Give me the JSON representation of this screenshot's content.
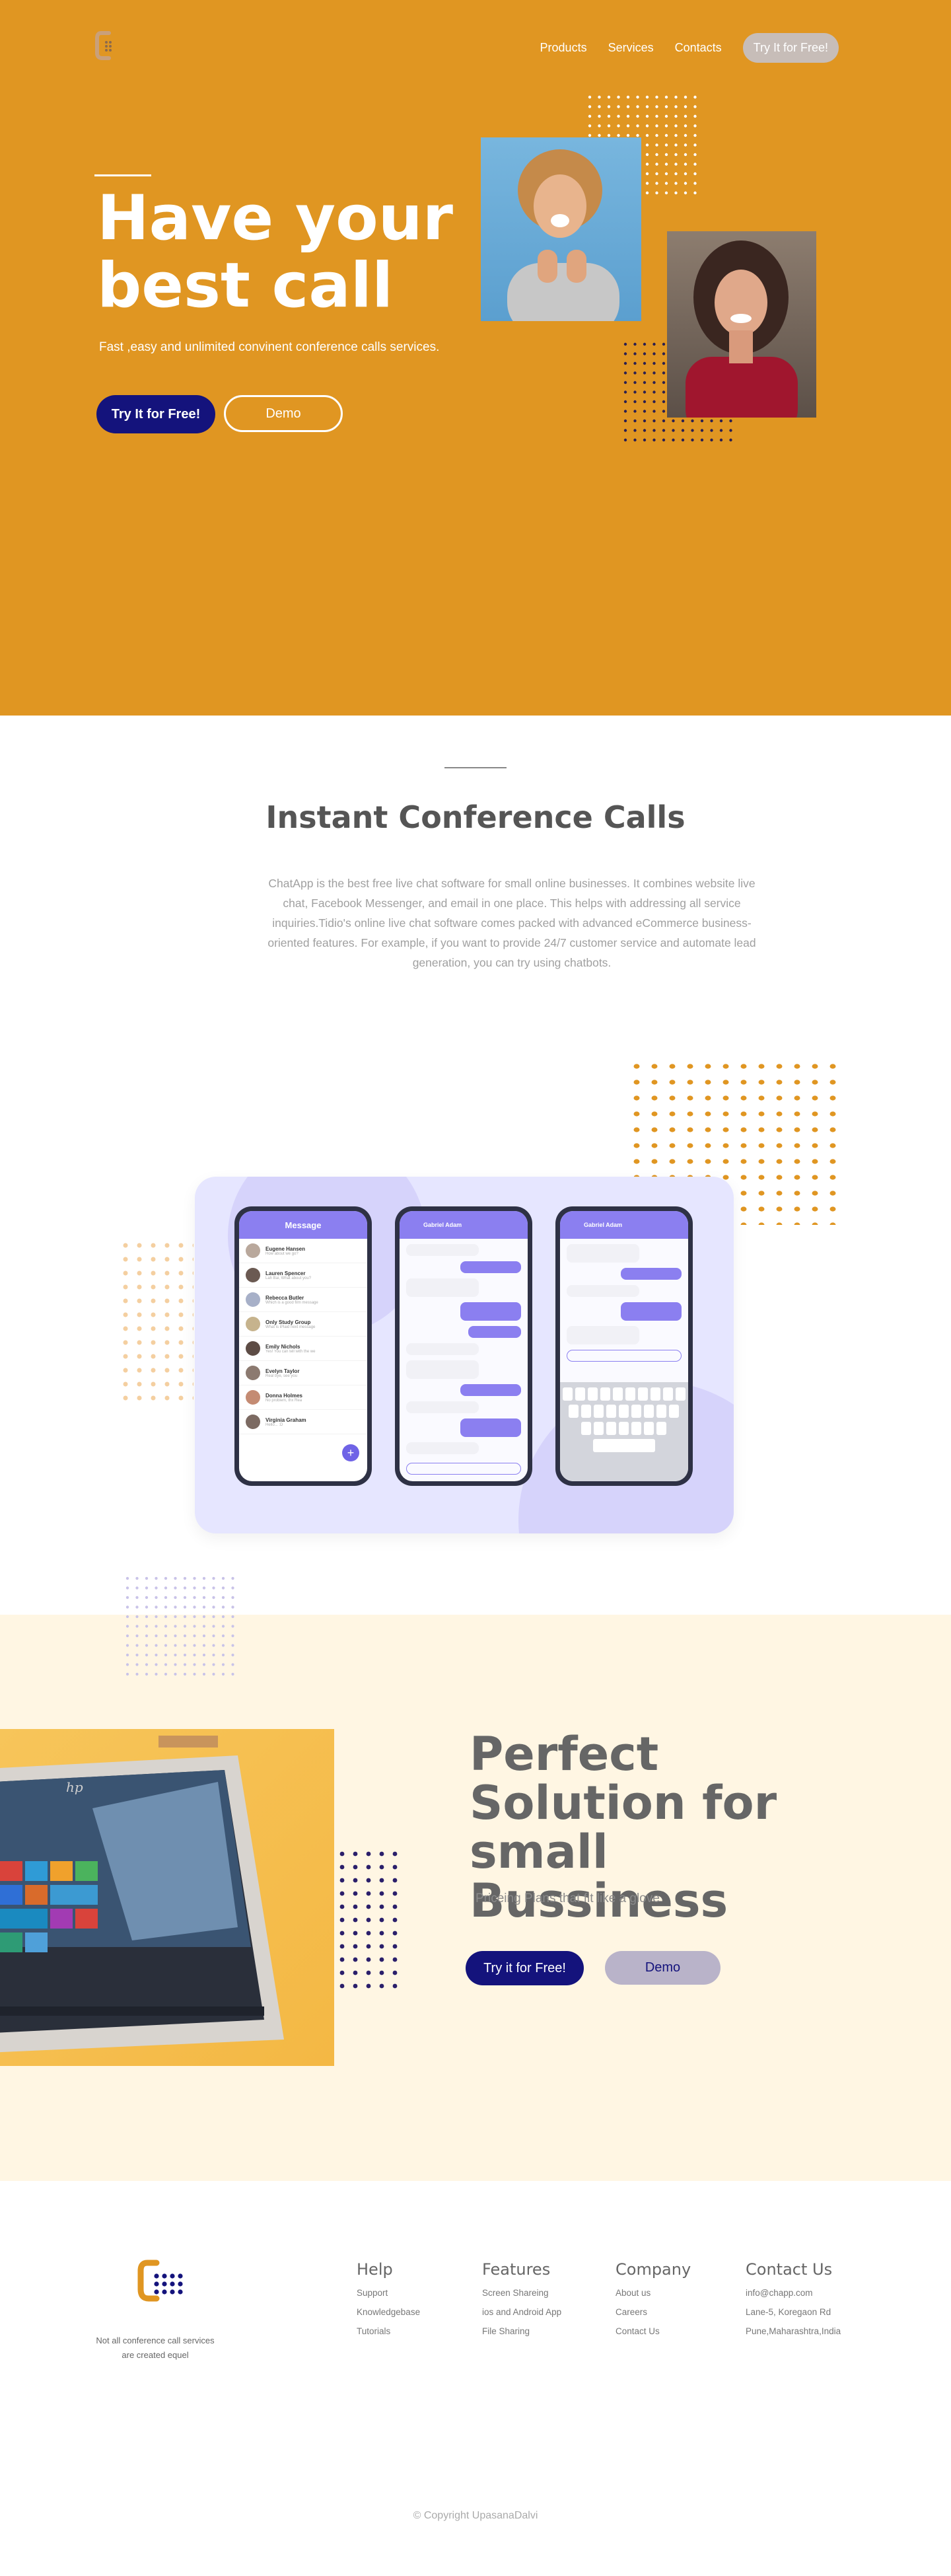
{
  "nav": {
    "items": [
      "Products",
      "Services",
      "Contacts"
    ],
    "cta": "Try It for Free!"
  },
  "hero": {
    "title": "Have your best call",
    "subtitle": "Fast ,easy  and unlimited convinent conference calls services.",
    "try_label": "Try It for Free!",
    "demo_label": "Demo"
  },
  "instant": {
    "title": "Instant  Conference Calls",
    "text": "ChatApp is the best free live chat software for small online businesses. It combines website live chat, Facebook Messenger, and email in one place. This helps with addressing all service inquiries.Tidio's online live chat software comes packed with advanced eCommerce business-oriented features. For example, if you want to provide 24/7 customer service and automate lead generation, you can try using chatbots."
  },
  "app_mock": {
    "header": "Message",
    "contacts": [
      {
        "name": "Eugene Hansen",
        "preview": "How about we go?"
      },
      {
        "name": "Lauren Spencer",
        "preview": "Lah Bai, What about you?"
      },
      {
        "name": "Rebecca Butler",
        "preview": "Which is a good film message"
      },
      {
        "name": "Only Study Group",
        "preview": "What is iPlaid next message"
      },
      {
        "name": "Emily Nichols",
        "preview": "Yes! You can tell with the we"
      },
      {
        "name": "Evelyn Taylor",
        "preview": "Real bye, see you"
      },
      {
        "name": "Donna Holmes",
        "preview": "No problem, thx Rea"
      },
      {
        "name": "Virginia Graham",
        "preview": "Hello... :D"
      }
    ],
    "chat_contact": "Gabriel Adam"
  },
  "solution": {
    "title": "Perfect Solution for small Bussiness",
    "subtitle": "Priceing Plans that fit like a glove",
    "try_label": "Try it for Free!",
    "demo_label": "Demo"
  },
  "footer": {
    "tagline": "Not all conference call services are created equel",
    "columns": [
      {
        "title": "Help",
        "links": [
          "Support",
          "Knowledgebase",
          "Tutorials"
        ]
      },
      {
        "title": "Features",
        "links": [
          "Screen Shareing",
          "ios and Android App",
          "File Sharing"
        ]
      },
      {
        "title": "Company",
        "links": [
          "About us",
          "Careers",
          "Contact Us"
        ]
      },
      {
        "title": "Contact Us",
        "links": [
          "info@chapp.com",
          "Lane-5, Koregaon Rd",
          "Pune,Maharashtra,India"
        ]
      }
    ],
    "copyright": "© Copyright UpasanaDalvi"
  },
  "colors": {
    "hero_bg": "#e09622",
    "navy": "#14137c",
    "purple": "#8b7ff0",
    "cream": "#fff6e3",
    "orange_dot": "#e09622"
  }
}
